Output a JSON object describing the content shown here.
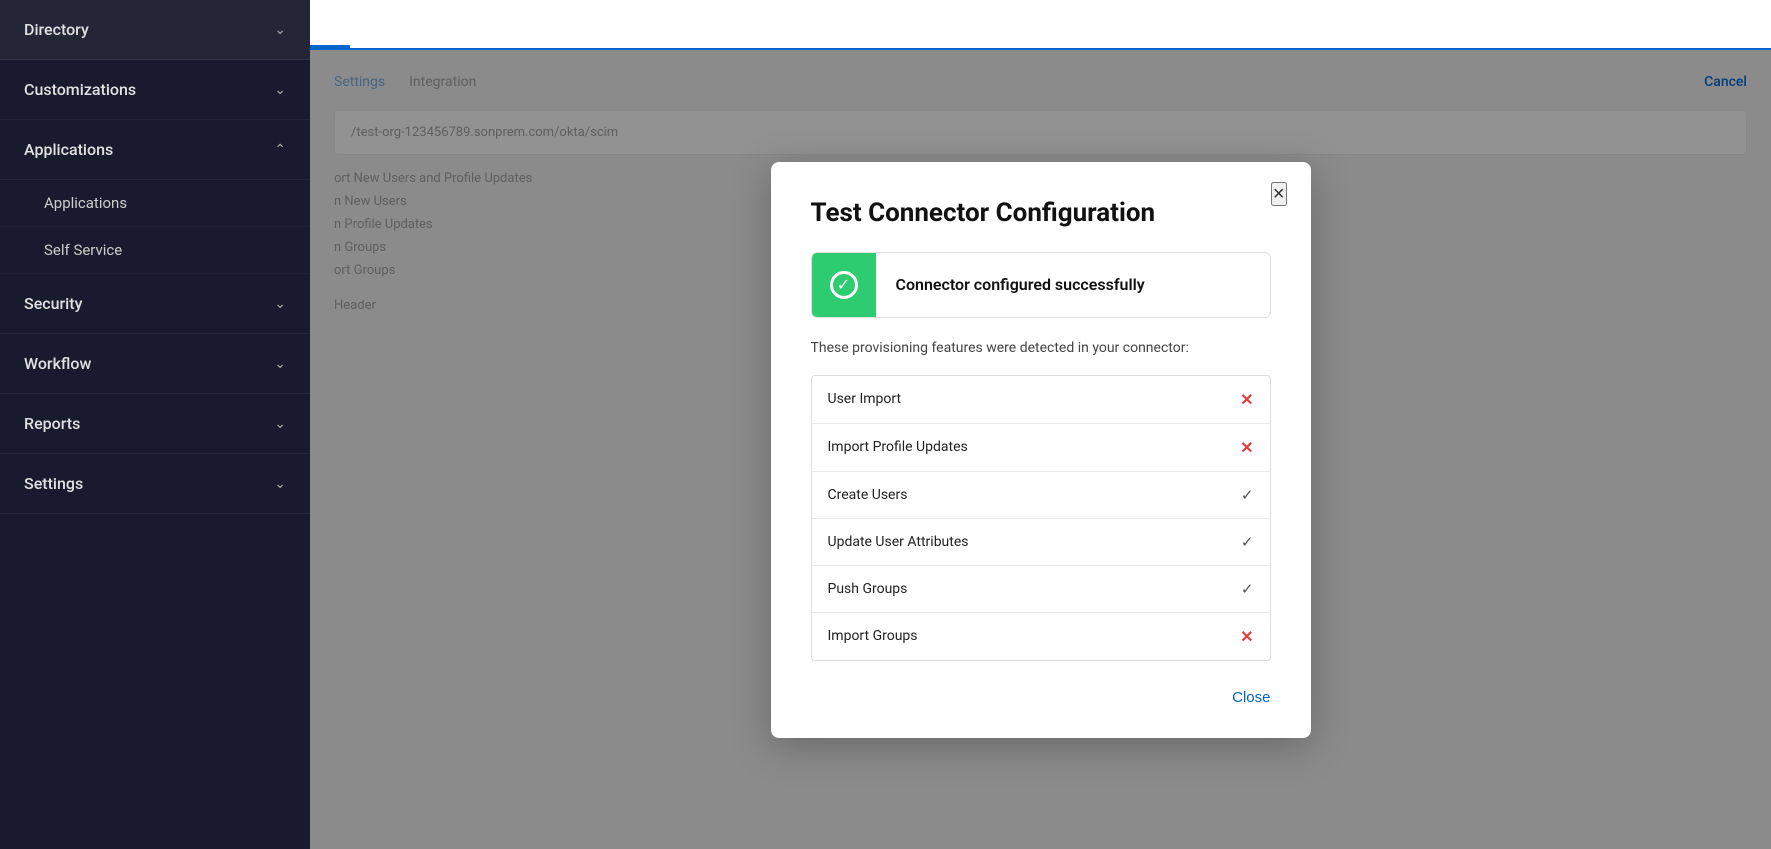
{
  "sidebar": {
    "items": [
      {
        "id": "directory",
        "label": "Directory",
        "expanded": false,
        "chevron": "chevron-down"
      },
      {
        "id": "customizations",
        "label": "Customizations",
        "expanded": false,
        "chevron": "chevron-down"
      },
      {
        "id": "applications",
        "label": "Applications",
        "expanded": true,
        "chevron": "chevron-up",
        "children": [
          {
            "id": "applications-sub",
            "label": "Applications"
          },
          {
            "id": "self-service",
            "label": "Self Service"
          }
        ]
      },
      {
        "id": "security",
        "label": "Security",
        "expanded": false,
        "chevron": "chevron-down"
      },
      {
        "id": "workflow",
        "label": "Workflow",
        "expanded": false,
        "chevron": "chevron-down"
      },
      {
        "id": "reports",
        "label": "Reports",
        "expanded": false,
        "chevron": "chevron-down"
      },
      {
        "id": "settings",
        "label": "Settings",
        "expanded": false,
        "chevron": "chevron-down"
      }
    ]
  },
  "main": {
    "cancel_label": "Cancel",
    "settings_nav": {
      "settings_label": "Settings",
      "integration_label": "Integration"
    },
    "scim_url": "/test-org-123456789.sonprem.com/okta/scim",
    "bg_features": [
      "ort New Users and Profile Updates",
      "n New Users",
      "n Profile Updates",
      "n Groups",
      "ort Groups"
    ],
    "header_label": "Header"
  },
  "modal": {
    "title": "Test Connector Configuration",
    "close_label": "×",
    "success_banner": {
      "text": "Connector configured successfully"
    },
    "detected_text": "These provisioning features were detected in your connector:",
    "features": [
      {
        "id": "user-import",
        "label": "User Import",
        "icon_type": "x"
      },
      {
        "id": "import-profile-updates",
        "label": "Import Profile Updates",
        "icon_type": "x"
      },
      {
        "id": "create-users",
        "label": "Create Users",
        "icon_type": "check"
      },
      {
        "id": "update-user-attributes",
        "label": "Update User Attributes",
        "icon_type": "check"
      },
      {
        "id": "push-groups",
        "label": "Push Groups",
        "icon_type": "check"
      },
      {
        "id": "import-groups",
        "label": "Import Groups",
        "icon_type": "x"
      }
    ],
    "close_button_label": "Close"
  }
}
